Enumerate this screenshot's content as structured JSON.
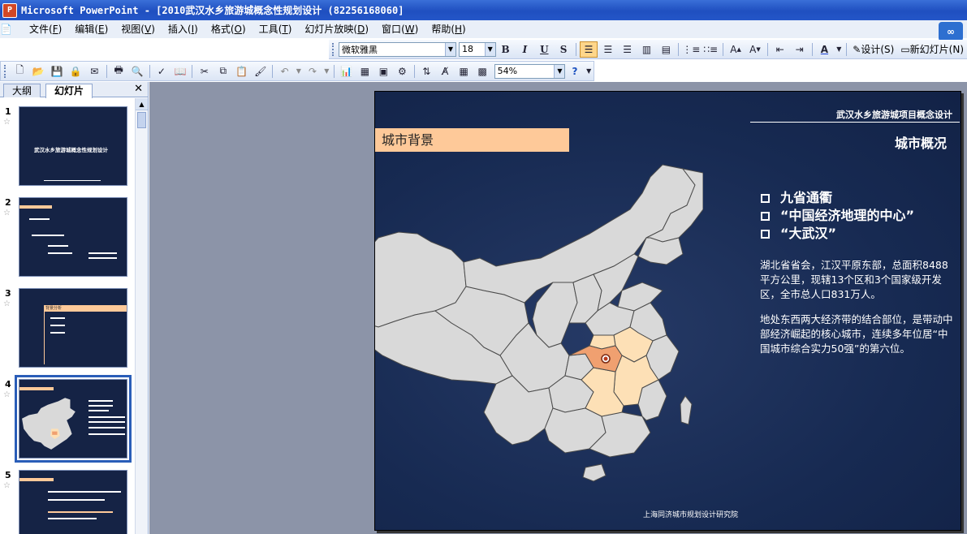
{
  "window": {
    "title": "Microsoft PowerPoint - [2010武汉水乡旅游城概念性规划设计 (82256168060]"
  },
  "menu": [
    {
      "label": "文件",
      "key": "F"
    },
    {
      "label": "编辑",
      "key": "E"
    },
    {
      "label": "视图",
      "key": "V"
    },
    {
      "label": "插入",
      "key": "I"
    },
    {
      "label": "格式",
      "key": "O"
    },
    {
      "label": "工具",
      "key": "T"
    },
    {
      "label": "幻灯片放映",
      "key": "D"
    },
    {
      "label": "窗口",
      "key": "W"
    },
    {
      "label": "帮助",
      "key": "H"
    }
  ],
  "format_toolbar": {
    "font": "微软雅黑",
    "size": "18",
    "design_label": "设计(S)",
    "new_slide_label": "新幻灯片(N)"
  },
  "standard_toolbar": {
    "zoom": "54%"
  },
  "panel": {
    "tabs": [
      "大纲",
      "幻灯片"
    ],
    "active_tab": "幻灯片"
  },
  "thumbnails": [
    {
      "num": "1",
      "title": "武汉水乡旅游城概念性规划设计"
    },
    {
      "num": "2"
    },
    {
      "num": "3",
      "title": "背景分析"
    },
    {
      "num": "4",
      "selected": true
    },
    {
      "num": "5"
    }
  ],
  "slide": {
    "top_title": "武汉水乡旅游城项目概念设计",
    "section_label": "城市背景",
    "right_title": "城市概况",
    "bullets": [
      "九省通衢",
      "“中国经济地理的中心”",
      "“大武汉”"
    ],
    "paragraph1": "湖北省省会，江汉平原东部，总面积8488平方公里，现辖13个区和3个国家级开发区，全市总人口831万人。",
    "paragraph2": "地处东西两大经济带的结合部位，是带动中部经济崛起的核心城市，连续多年位居“中国城市综合实力50强”的第六位。",
    "footer": "上海同济城市规划设计研究院"
  },
  "colors": {
    "titlebar": "#2456c8",
    "slide_bg": "#172a52",
    "label_bg": "#fec999",
    "map_fill": "#d9d9d9",
    "hubei": "#f0a070",
    "neighbors": "#fde0b6"
  }
}
